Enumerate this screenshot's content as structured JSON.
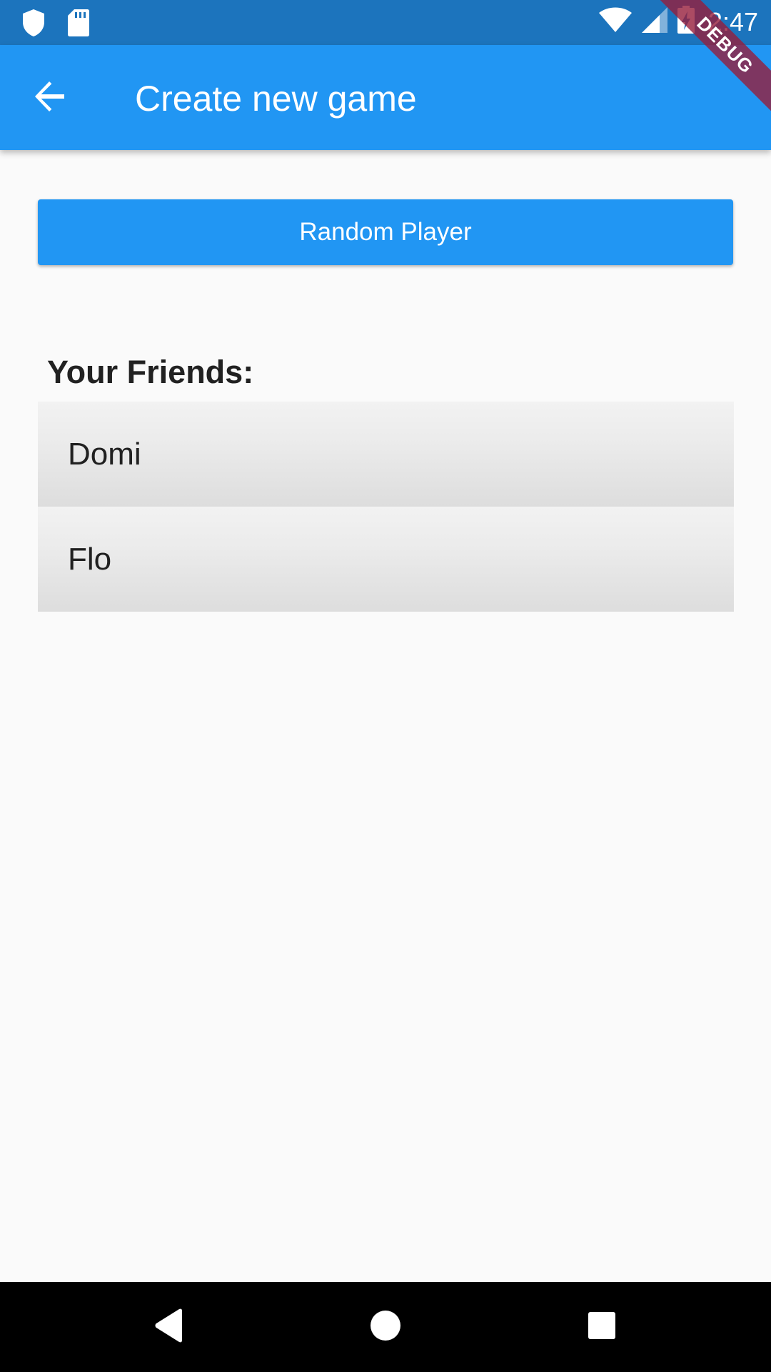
{
  "status_bar": {
    "time": "2:47",
    "left_icons": [
      "shield-icon",
      "sd-card-icon"
    ],
    "right_icons": [
      "wifi-icon",
      "cell-signal-icon",
      "battery-charging-icon"
    ],
    "color": "#1c74bd"
  },
  "app_bar": {
    "title": "Create new game",
    "back_icon": "arrow-back-icon",
    "color": "#2196f3"
  },
  "debug_banner": {
    "label": "DEBUG"
  },
  "main": {
    "random_button_label": "Random Player",
    "friends_heading": "Your Friends:",
    "friends": [
      {
        "name": "Domi"
      },
      {
        "name": "Flo"
      }
    ]
  },
  "nav_bar": {
    "buttons": [
      "back-triangle-icon",
      "home-circle-icon",
      "recents-square-icon"
    ]
  }
}
